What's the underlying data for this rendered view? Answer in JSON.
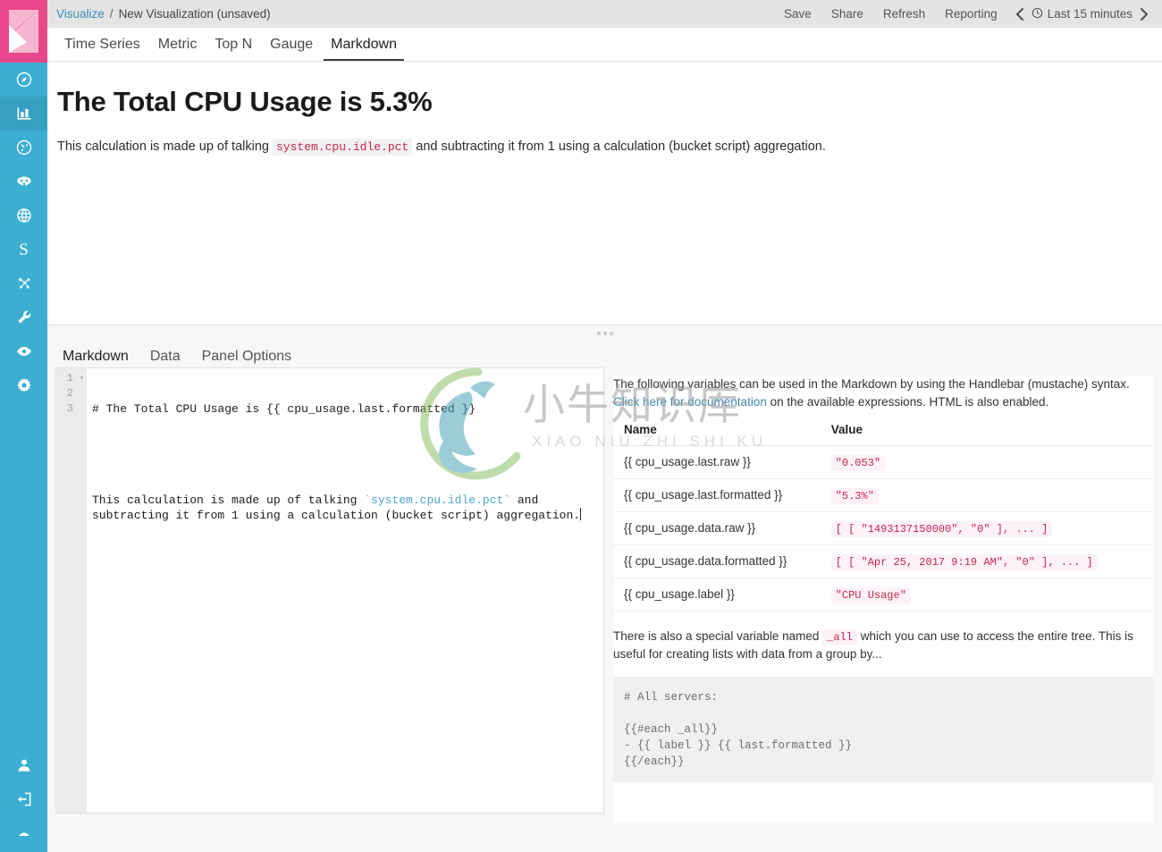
{
  "app": {
    "logo_name": "kibana-logo"
  },
  "breadcrumb": {
    "root": "Visualize",
    "separator": "/",
    "current": "New Visualization (unsaved)"
  },
  "topbar": {
    "save_label": "Save",
    "share_label": "Share",
    "refresh_label": "Refresh",
    "reporting_label": "Reporting",
    "prev_arrow": "‹",
    "next_arrow": "›",
    "time_range": "Last 15 minutes"
  },
  "sidebar": {
    "items": [
      {
        "name": "discover",
        "icon": "compass-icon",
        "active": false
      },
      {
        "name": "visualize",
        "icon": "bar-chart-icon",
        "active": true
      },
      {
        "name": "dashboard",
        "icon": "dashboard-gauge-icon",
        "active": false
      },
      {
        "name": "timelion",
        "icon": "timelion-icon",
        "active": false
      },
      {
        "name": "apm",
        "icon": "apm-globe-icon",
        "active": false
      },
      {
        "name": "sense",
        "icon": "sense-s-icon",
        "active": false
      },
      {
        "name": "graph",
        "icon": "graph-nodes-icon",
        "active": false
      },
      {
        "name": "dev-tools",
        "icon": "wrench-icon",
        "active": false
      },
      {
        "name": "monitoring",
        "icon": "eye-icon",
        "active": false
      },
      {
        "name": "management",
        "icon": "gear-icon",
        "active": false
      }
    ],
    "bottom_items": [
      {
        "name": "user",
        "icon": "user-icon"
      },
      {
        "name": "logout",
        "icon": "logout-icon"
      }
    ],
    "sense_letter": "S"
  },
  "vis_tabs": [
    {
      "label": "Time Series",
      "active": false
    },
    {
      "label": "Metric",
      "active": false
    },
    {
      "label": "Top N",
      "active": false
    },
    {
      "label": "Gauge",
      "active": false
    },
    {
      "label": "Markdown",
      "active": true
    }
  ],
  "preview": {
    "heading": "The Total CPU Usage is 5.3%",
    "para_before": "This calculation is made up of talking",
    "para_code": "system.cpu.idle.pct",
    "para_after": "and subtracting it from 1 using a calculation (bucket script) aggregation."
  },
  "panel_tabs": [
    {
      "label": "Markdown",
      "active": true
    },
    {
      "label": "Data",
      "active": false
    },
    {
      "label": "Panel Options",
      "active": false
    }
  ],
  "editor": {
    "line_numbers": [
      "1",
      "2",
      "3"
    ],
    "line1": "# The Total CPU Usage is {{ cpu_usage.last.formatted }}",
    "line2": "",
    "line3_a": "This calculation is made up of talking ",
    "line3_code": "`system.cpu.idle.pct`",
    "line3_b": " and subtracting it from 1 using a calculation (bucket script) aggregation."
  },
  "help": {
    "intro_part1": "The following variables can be used in the Markdown by using the Handlebar (mustache) syntax. ",
    "intro_link": "Click here for documentation",
    "intro_part2": " on the available expressions. HTML is also enabled.",
    "table_headers": {
      "name": "Name",
      "value": "Value"
    },
    "rows": [
      {
        "name": "{{ cpu_usage.last.raw }}",
        "value": "\"0.053\""
      },
      {
        "name": "{{ cpu_usage.last.formatted }}",
        "value": "\"5.3%\""
      },
      {
        "name": "{{ cpu_usage.data.raw }}",
        "value": "[ [ \"1493137150000\", \"0\" ], ... ]"
      },
      {
        "name": "{{ cpu_usage.data.formatted }}",
        "value": "[ [ \"Apr 25, 2017 9:19 AM\", \"0\" ], ... ]"
      },
      {
        "name": "{{ cpu_usage.label }}",
        "value": "\"CPU Usage\""
      }
    ],
    "note_part1": "There is also a special variable named ",
    "note_code": "_all",
    "note_part2": " which you can use to access the entire tree. This is useful for creating lists with data from a group by...",
    "code_block": "# All servers:\n\n{{#each _all}}\n- {{ label }} {{ last.formatted }}\n{{/each}}"
  },
  "watermark": {
    "text": "小牛知识库",
    "subtext": "XIAO NIU ZHI SHI KU"
  },
  "colors": {
    "sidebar": "#3caed2",
    "logo": "#e8488b",
    "link": "#3f8bb2",
    "code_red": "#c7254e",
    "header_bg": "#e4e4e4"
  }
}
